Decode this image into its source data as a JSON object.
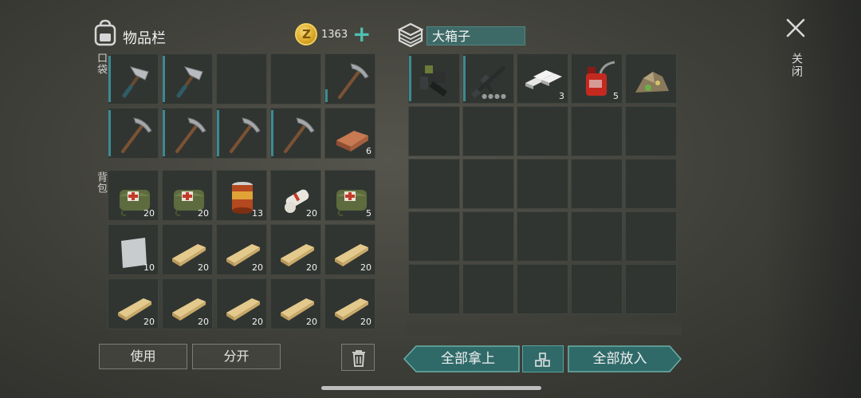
{
  "inventory": {
    "title": "物品栏",
    "coins": "1363",
    "coin_symbol": "Z",
    "pocket_label": "口袋",
    "backpack_label": "背包",
    "pocket": [
      {
        "icon": "hammer-icon",
        "qty": ""
      },
      {
        "icon": "hammer-icon",
        "qty": ""
      },
      {
        "icon": "",
        "qty": ""
      },
      {
        "icon": "",
        "qty": ""
      },
      {
        "icon": "pickaxe-icon",
        "qty": ""
      },
      {
        "icon": "pickaxe-icon",
        "qty": ""
      },
      {
        "icon": "pickaxe-icon",
        "qty": ""
      },
      {
        "icon": "pickaxe-icon",
        "qty": ""
      },
      {
        "icon": "pickaxe-icon",
        "qty": ""
      },
      {
        "icon": "copper-ingot-icon",
        "qty": "6"
      }
    ],
    "backpack": [
      {
        "icon": "medkit-bag-icon",
        "qty": "20"
      },
      {
        "icon": "medkit-bag-icon",
        "qty": "20"
      },
      {
        "icon": "food-can-icon",
        "qty": "13"
      },
      {
        "icon": "bandage-icon",
        "qty": "20"
      },
      {
        "icon": "medkit-bag-icon",
        "qty": "5"
      },
      {
        "icon": "metal-sheet-icon",
        "qty": "10"
      },
      {
        "icon": "plank-icon",
        "qty": "20"
      },
      {
        "icon": "plank-icon",
        "qty": "20"
      },
      {
        "icon": "plank-icon",
        "qty": "20"
      },
      {
        "icon": "plank-icon",
        "qty": "20"
      },
      {
        "icon": "plank-icon",
        "qty": "20"
      },
      {
        "icon": "plank-icon",
        "qty": "20"
      },
      {
        "icon": "plank-icon",
        "qty": "20"
      },
      {
        "icon": "plank-icon",
        "qty": "20"
      },
      {
        "icon": "plank-icon",
        "qty": "20"
      }
    ]
  },
  "chest": {
    "name": "大箱子",
    "items": [
      {
        "icon": "grenade-launcher-icon",
        "qty": ""
      },
      {
        "icon": "assault-rifle-icon",
        "qty": ""
      },
      {
        "icon": "iron-ingot-icon",
        "qty": "3"
      },
      {
        "icon": "gas-can-icon",
        "qty": "5"
      },
      {
        "icon": "ore-pile-icon",
        "qty": ""
      }
    ],
    "total_slots": 25
  },
  "actions": {
    "use": "使用",
    "split": "分开",
    "take_all": "全部拿上",
    "put_all": "全部放入",
    "close": "关闭"
  },
  "colors": {
    "accent": "#3b8a92",
    "button_teal": "#2f6a69",
    "coin": "#d9a726"
  }
}
